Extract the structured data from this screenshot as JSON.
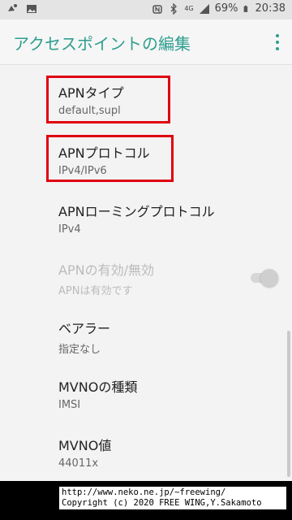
{
  "status_bar": {
    "left_icons": [
      "notification-icon",
      "image-icon"
    ],
    "right_icons": [
      "nfc-icon",
      "bluetooth-icon",
      "signal-4g-icon",
      "battery-icon"
    ],
    "network_label": "4G",
    "battery": "69%",
    "time": "20:38"
  },
  "appbar": {
    "title": "アクセスポイントの編集",
    "overflow_icon": "more-vert-icon",
    "accent": "#2f9e8f"
  },
  "items": [
    {
      "title": "APNタイプ",
      "summary": "default,supl"
    },
    {
      "title": "APNプロトコル",
      "summary": "IPv4/IPv6"
    },
    {
      "title": "APNローミングプロトコル",
      "summary": "IPv4"
    },
    {
      "title": "APNの有効/無効",
      "summary": "APNは有効です"
    },
    {
      "title": "ベアラー",
      "summary": "指定なし"
    },
    {
      "title": "MVNOの種類",
      "summary": "IMSI"
    },
    {
      "title": "MVNO値",
      "summary": "44011x"
    }
  ],
  "credit": {
    "line1": "http://www.neko.ne.jp/~freewing/",
    "line2": "Copyright (c) 2020 FREE WING,Y.Sakamoto"
  },
  "highlight_color": "#e00010"
}
